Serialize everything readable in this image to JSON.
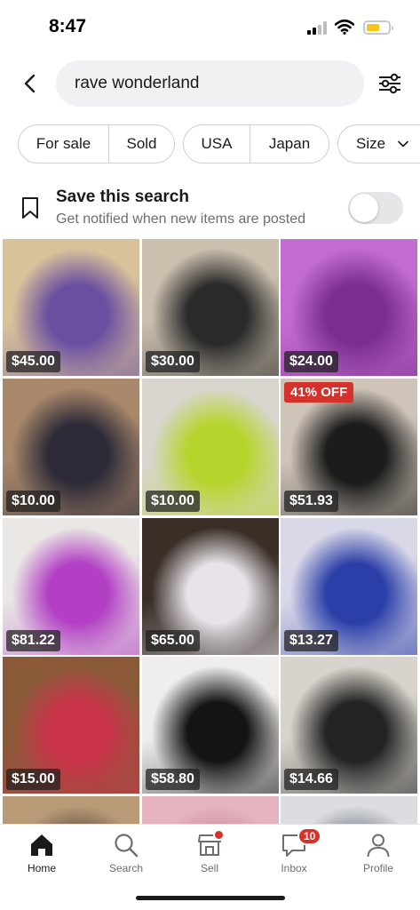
{
  "status_bar": {
    "time": "8:47"
  },
  "search": {
    "query": "rave wonderland"
  },
  "filters": {
    "condition": [
      "For sale",
      "Sold"
    ],
    "country": [
      "USA",
      "Japan"
    ],
    "size": "Size"
  },
  "save_search": {
    "title": "Save this search",
    "subtitle": "Get notified when new items are posted",
    "enabled": false
  },
  "listings": [
    {
      "price": "$45.00",
      "badge": "",
      "colors": [
        "#d9c29a",
        "#6a4fa0"
      ]
    },
    {
      "price": "$30.00",
      "badge": "",
      "colors": [
        "#cbbfae",
        "#2a2a2a"
      ]
    },
    {
      "price": "$24.00",
      "badge": "",
      "colors": [
        "#c36bd1",
        "#7a2f8f"
      ]
    },
    {
      "price": "$10.00",
      "badge": "",
      "colors": [
        "#a8876a",
        "#2d2a38"
      ]
    },
    {
      "price": "$10.00",
      "badge": "",
      "colors": [
        "#d8d5cf",
        "#b6d52c"
      ]
    },
    {
      "price": "$51.93",
      "badge": "41% OFF",
      "colors": [
        "#cfc4b8",
        "#1c1c1c"
      ]
    },
    {
      "price": "$81.22",
      "badge": "",
      "colors": [
        "#e9e6e4",
        "#b23fc4"
      ]
    },
    {
      "price": "$65.00",
      "badge": "",
      "colors": [
        "#3a2e27",
        "#e7e3e9"
      ]
    },
    {
      "price": "$13.27",
      "badge": "",
      "colors": [
        "#d9d8e8",
        "#2c3fa8"
      ]
    },
    {
      "price": "$15.00",
      "badge": "",
      "colors": [
        "#8a5a38",
        "#c9344a"
      ]
    },
    {
      "price": "$58.80",
      "badge": "",
      "colors": [
        "#efeeec",
        "#141414"
      ]
    },
    {
      "price": "$14.66",
      "badge": "",
      "colors": [
        "#d8d3cc",
        "#232323"
      ]
    },
    {
      "price": "",
      "badge": "",
      "colors": [
        "#b89a77",
        "#5b4a3a"
      ]
    },
    {
      "price": "",
      "badge": "",
      "colors": [
        "#e5b3c0",
        "#c98b9c"
      ]
    },
    {
      "price": "",
      "badge": "",
      "colors": [
        "#dcdde0",
        "#6f7680"
      ]
    }
  ],
  "nav": {
    "home": "Home",
    "search": "Search",
    "sell": "Sell",
    "inbox": "Inbox",
    "inbox_count": "10",
    "profile": "Profile"
  },
  "colors": {
    "accent": "#d6322c",
    "chip_border": "#cfcfcf",
    "pill_bg": "#f1f1f3"
  },
  "icons": [
    "back-arrow-icon",
    "filter-sliders-icon",
    "chevron-down-icon",
    "bookmark-icon",
    "home-icon",
    "search-icon",
    "shop-icon",
    "inbox-icon",
    "profile-icon"
  ]
}
